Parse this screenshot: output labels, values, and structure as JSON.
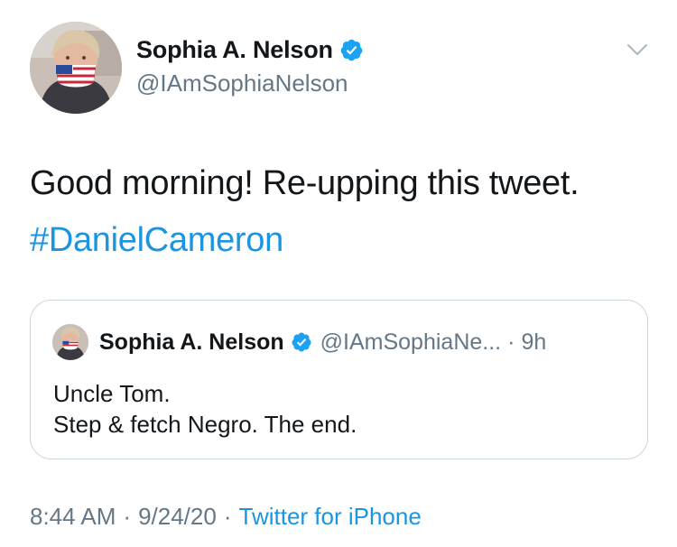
{
  "author": {
    "display_name": "Sophia A. Nelson",
    "handle": "@IAmSophiaNelson"
  },
  "tweet": {
    "text": "Good morning! Re-upping this tweet.",
    "hashtag": "#DanielCameron"
  },
  "quoted_tweet": {
    "display_name": "Sophia A. Nelson",
    "handle": "@IAmSophiaNe...",
    "separator": "·",
    "time": "9h",
    "lines": [
      "Uncle Tom.",
      "Step & fetch Negro. The end."
    ]
  },
  "meta": {
    "time": "8:44 AM",
    "separator": "·",
    "date": "9/24/20",
    "source": "Twitter for iPhone"
  },
  "colors": {
    "accent": "#1b95e0",
    "secondary_text": "#657786",
    "border": "#ccd6dd"
  },
  "icons": [
    "verified-badge-icon",
    "chevron-down-icon"
  ]
}
